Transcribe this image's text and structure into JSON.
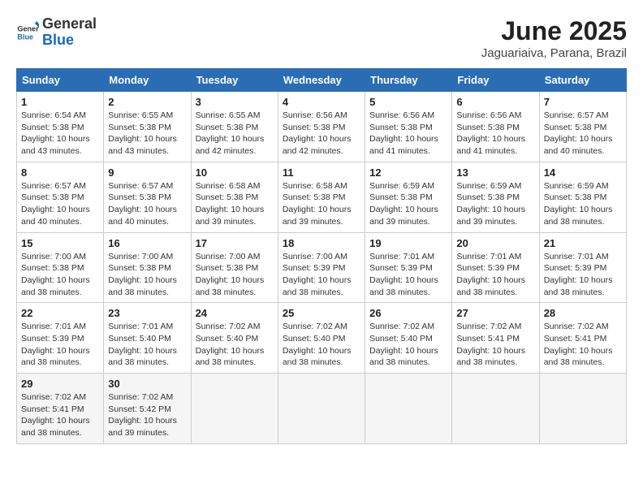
{
  "header": {
    "logo_general": "General",
    "logo_blue": "Blue",
    "month_title": "June 2025",
    "location": "Jaguariaiva, Parana, Brazil"
  },
  "weekdays": [
    "Sunday",
    "Monday",
    "Tuesday",
    "Wednesday",
    "Thursday",
    "Friday",
    "Saturday"
  ],
  "weeks": [
    [
      {
        "day": "1",
        "sunrise": "6:54 AM",
        "sunset": "5:38 PM",
        "daylight": "10 hours and 43 minutes."
      },
      {
        "day": "2",
        "sunrise": "6:55 AM",
        "sunset": "5:38 PM",
        "daylight": "10 hours and 43 minutes."
      },
      {
        "day": "3",
        "sunrise": "6:55 AM",
        "sunset": "5:38 PM",
        "daylight": "10 hours and 42 minutes."
      },
      {
        "day": "4",
        "sunrise": "6:56 AM",
        "sunset": "5:38 PM",
        "daylight": "10 hours and 42 minutes."
      },
      {
        "day": "5",
        "sunrise": "6:56 AM",
        "sunset": "5:38 PM",
        "daylight": "10 hours and 41 minutes."
      },
      {
        "day": "6",
        "sunrise": "6:56 AM",
        "sunset": "5:38 PM",
        "daylight": "10 hours and 41 minutes."
      },
      {
        "day": "7",
        "sunrise": "6:57 AM",
        "sunset": "5:38 PM",
        "daylight": "10 hours and 40 minutes."
      }
    ],
    [
      {
        "day": "8",
        "sunrise": "6:57 AM",
        "sunset": "5:38 PM",
        "daylight": "10 hours and 40 minutes."
      },
      {
        "day": "9",
        "sunrise": "6:57 AM",
        "sunset": "5:38 PM",
        "daylight": "10 hours and 40 minutes."
      },
      {
        "day": "10",
        "sunrise": "6:58 AM",
        "sunset": "5:38 PM",
        "daylight": "10 hours and 39 minutes."
      },
      {
        "day": "11",
        "sunrise": "6:58 AM",
        "sunset": "5:38 PM",
        "daylight": "10 hours and 39 minutes."
      },
      {
        "day": "12",
        "sunrise": "6:59 AM",
        "sunset": "5:38 PM",
        "daylight": "10 hours and 39 minutes."
      },
      {
        "day": "13",
        "sunrise": "6:59 AM",
        "sunset": "5:38 PM",
        "daylight": "10 hours and 39 minutes."
      },
      {
        "day": "14",
        "sunrise": "6:59 AM",
        "sunset": "5:38 PM",
        "daylight": "10 hours and 38 minutes."
      }
    ],
    [
      {
        "day": "15",
        "sunrise": "7:00 AM",
        "sunset": "5:38 PM",
        "daylight": "10 hours and 38 minutes."
      },
      {
        "day": "16",
        "sunrise": "7:00 AM",
        "sunset": "5:38 PM",
        "daylight": "10 hours and 38 minutes."
      },
      {
        "day": "17",
        "sunrise": "7:00 AM",
        "sunset": "5:38 PM",
        "daylight": "10 hours and 38 minutes."
      },
      {
        "day": "18",
        "sunrise": "7:00 AM",
        "sunset": "5:39 PM",
        "daylight": "10 hours and 38 minutes."
      },
      {
        "day": "19",
        "sunrise": "7:01 AM",
        "sunset": "5:39 PM",
        "daylight": "10 hours and 38 minutes."
      },
      {
        "day": "20",
        "sunrise": "7:01 AM",
        "sunset": "5:39 PM",
        "daylight": "10 hours and 38 minutes."
      },
      {
        "day": "21",
        "sunrise": "7:01 AM",
        "sunset": "5:39 PM",
        "daylight": "10 hours and 38 minutes."
      }
    ],
    [
      {
        "day": "22",
        "sunrise": "7:01 AM",
        "sunset": "5:39 PM",
        "daylight": "10 hours and 38 minutes."
      },
      {
        "day": "23",
        "sunrise": "7:01 AM",
        "sunset": "5:40 PM",
        "daylight": "10 hours and 38 minutes."
      },
      {
        "day": "24",
        "sunrise": "7:02 AM",
        "sunset": "5:40 PM",
        "daylight": "10 hours and 38 minutes."
      },
      {
        "day": "25",
        "sunrise": "7:02 AM",
        "sunset": "5:40 PM",
        "daylight": "10 hours and 38 minutes."
      },
      {
        "day": "26",
        "sunrise": "7:02 AM",
        "sunset": "5:40 PM",
        "daylight": "10 hours and 38 minutes."
      },
      {
        "day": "27",
        "sunrise": "7:02 AM",
        "sunset": "5:41 PM",
        "daylight": "10 hours and 38 minutes."
      },
      {
        "day": "28",
        "sunrise": "7:02 AM",
        "sunset": "5:41 PM",
        "daylight": "10 hours and 38 minutes."
      }
    ],
    [
      {
        "day": "29",
        "sunrise": "7:02 AM",
        "sunset": "5:41 PM",
        "daylight": "10 hours and 38 minutes."
      },
      {
        "day": "30",
        "sunrise": "7:02 AM",
        "sunset": "5:42 PM",
        "daylight": "10 hours and 39 minutes."
      },
      null,
      null,
      null,
      null,
      null
    ]
  ]
}
